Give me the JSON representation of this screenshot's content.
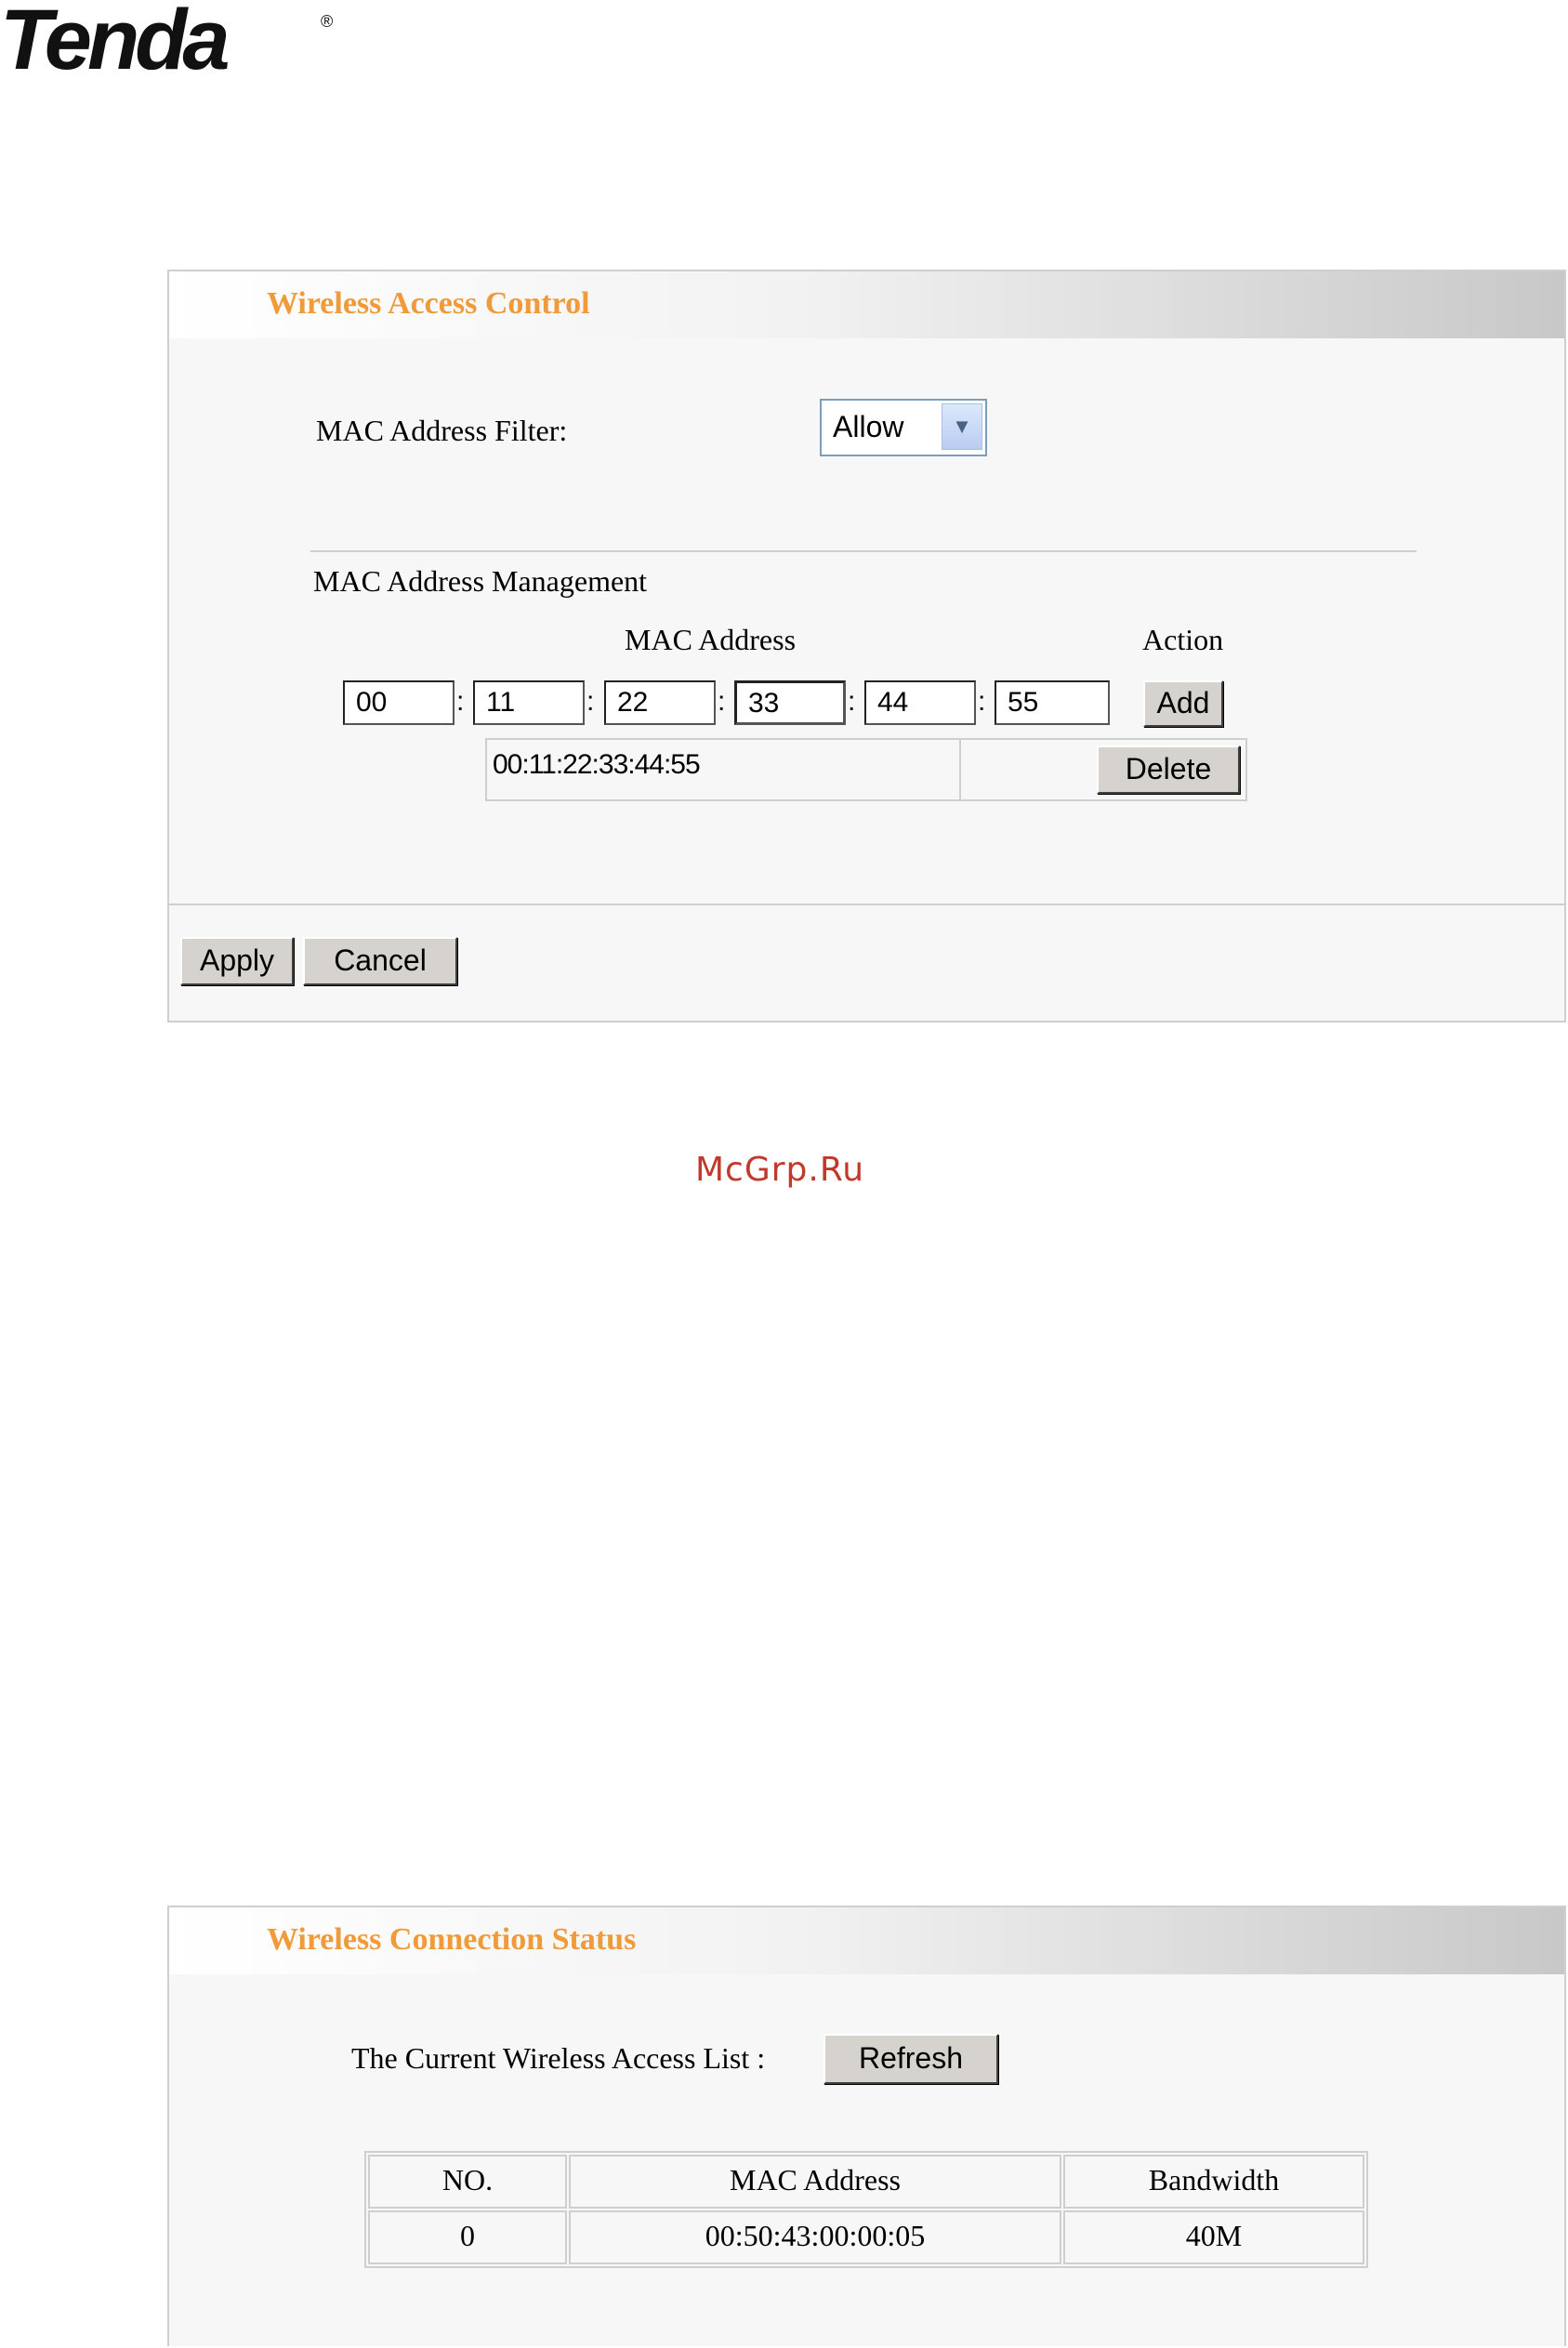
{
  "logo": {
    "text": "Tenda",
    "reg": "®"
  },
  "access_control": {
    "title": "Wireless Access Control",
    "filter_label": "MAC Address Filter:",
    "filter_value": "Allow",
    "management_label": "MAC Address Management",
    "mac_column": "MAC Address",
    "action_column": "Action",
    "mac_octets": [
      "00",
      "11",
      "22",
      "33",
      "44",
      "55"
    ],
    "separator": ":",
    "add_label": "Add",
    "entries": [
      {
        "mac": "00:11:22:33:44:55",
        "action": "Delete"
      }
    ],
    "apply_label": "Apply",
    "cancel_label": "Cancel"
  },
  "watermark": "McGrp.Ru",
  "connection_status": {
    "title": "Wireless Connection Status",
    "list_label": "The Current Wireless Access List :",
    "refresh_label": "Refresh",
    "columns": [
      "NO.",
      "MAC Address",
      "Bandwidth"
    ],
    "rows": [
      [
        "0",
        "00:50:43:00:00:05",
        "40M"
      ]
    ]
  },
  "colors": {
    "title_orange": "#f09a3a",
    "panel_bg": "#f7f7f7",
    "button_face": "#d6d3ce"
  }
}
